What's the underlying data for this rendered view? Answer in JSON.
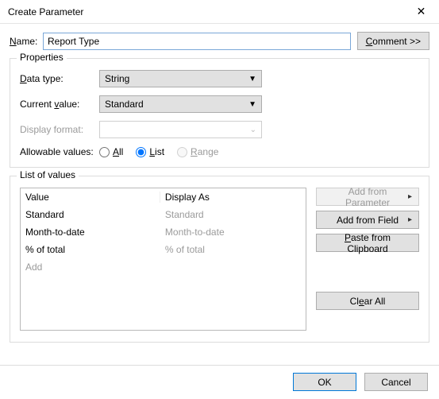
{
  "window": {
    "title": "Create Parameter",
    "close_icon": "✕"
  },
  "name": {
    "label": "Name:",
    "value": "Report Type"
  },
  "comment_btn": {
    "label": "Comment >>",
    "u": "C"
  },
  "properties": {
    "legend": "Properties",
    "data_type": {
      "label": "Data type:",
      "value": "String",
      "u": "D"
    },
    "current_value": {
      "label": "Current value:",
      "value": "Standard",
      "u": "v"
    },
    "display_format": {
      "label": "Display format:",
      "value": ""
    },
    "allowable": {
      "label": "Allowable values:",
      "all": {
        "label": "All",
        "u": "A"
      },
      "list": {
        "label": "List",
        "u": "L"
      },
      "range": {
        "label": "Range",
        "u": "R"
      }
    }
  },
  "list_of_values": {
    "legend": "List of values",
    "headers": {
      "value": "Value",
      "display_as": "Display As"
    },
    "rows": [
      {
        "value": "Standard",
        "display": "Standard"
      },
      {
        "value": "Month-to-date",
        "display": "Month-to-date"
      },
      {
        "value": "% of total",
        "display": "% of total"
      }
    ],
    "add_placeholder": "Add",
    "buttons": {
      "add_from_parameter": "Add from Parameter",
      "add_from_field": "Add from Field",
      "paste_from_clipboard": "Paste from Clipboard",
      "paste_u": "P",
      "clear_all": "Clear All",
      "clear_u": "e"
    }
  },
  "footer": {
    "ok": "OK",
    "cancel": "Cancel"
  }
}
